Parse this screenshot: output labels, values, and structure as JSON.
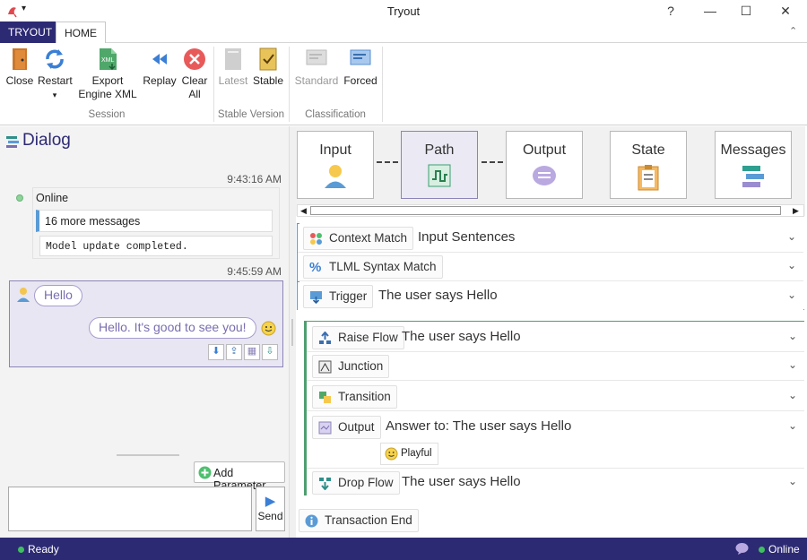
{
  "window": {
    "title": "Tryout",
    "help": "?",
    "minimize": "—",
    "maximize": "☐",
    "close": "✕"
  },
  "tabs": {
    "brand": "TRYOUT",
    "home": "HOME"
  },
  "ribbon": {
    "session": {
      "close": "Close",
      "restart": "Restart",
      "restart_arrow": "▾",
      "export1": "Export",
      "export2": "Engine XML",
      "replay": "Replay",
      "clear1": "Clear",
      "clear2": "All",
      "label": "Session"
    },
    "stable": {
      "latest": "Latest",
      "stable": "Stable",
      "label": "Stable Version"
    },
    "classification": {
      "standard": "Standard",
      "forced": "Forced",
      "label": "Classification"
    },
    "xml_badge": "XML"
  },
  "dialog": {
    "title": "Dialog",
    "time1": "9:43:16 AM",
    "status": "Online",
    "more": "16 more messages",
    "update": "Model update completed.",
    "time2": "9:45:59 AM",
    "user_msg": "Hello",
    "bot_msg": "Hello. It's good to see you!",
    "add_param": "Add Parameter",
    "send": "Send"
  },
  "nav": {
    "input": "Input",
    "path": "Path",
    "output": "Output",
    "state": "State",
    "messages": "Messages"
  },
  "rows": [
    {
      "chip": "Context Match",
      "desc": "Input Sentences"
    },
    {
      "chip": "TLML Syntax Match",
      "desc": ""
    },
    {
      "chip": "Trigger",
      "desc": "The user says Hello"
    },
    {
      "chip": "Raise Flow",
      "desc": "The user says Hello"
    },
    {
      "chip": "Junction",
      "desc": ""
    },
    {
      "chip": "Transition",
      "desc": ""
    },
    {
      "chip": "Output",
      "desc": "Answer to: The user says Hello"
    },
    {
      "chip": "Drop Flow",
      "desc": "The user says Hello"
    },
    {
      "chip": "Transaction End",
      "desc": ""
    }
  ],
  "tone": "Playful",
  "statusbar": {
    "ready": "Ready",
    "online": "Online"
  },
  "colors": {
    "brand": "#2d2a74",
    "accent": "#8c84b8",
    "green": "#3fbf5f"
  }
}
